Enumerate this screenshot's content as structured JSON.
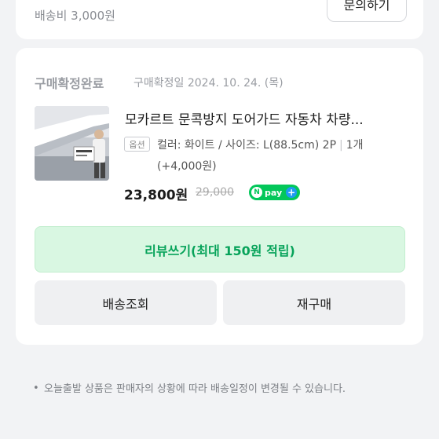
{
  "top_card": {
    "shipping_fee": "배송비 3,000원",
    "inquiry_button": "문의하기"
  },
  "order": {
    "status": "구매확정완료",
    "confirm_date": "구매확정일 2024. 10. 24. (목)",
    "product_title": "모카르트 문콕방지 도어가드 자동차 차량...",
    "option_badge": "옵션",
    "option_text": "컬러: 화이트 / 사이즈: L(88.5cm) 2P",
    "quantity": "1개",
    "option_extra": "(+4,000원)",
    "price": "23,800원",
    "original_price": "29,000",
    "npay_label": "pay"
  },
  "actions": {
    "review_button": "리뷰쓰기(최대 150원 적립)",
    "track_button": "배송조회",
    "rebuy_button": "재구매"
  },
  "notice": {
    "bullet": "•",
    "text": "오늘출발 상품은 판매자의 상황에 따라 배송일정이 변경될 수 있습니다."
  },
  "colors": {
    "brand_green": "#03c75a",
    "review_bg": "#d9f7e2"
  }
}
